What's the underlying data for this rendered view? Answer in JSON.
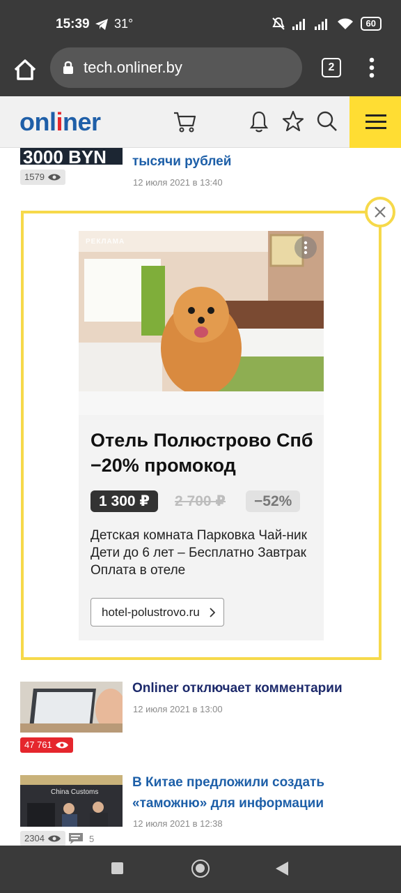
{
  "status_bar": {
    "time": "15:39",
    "temperature": "31°",
    "battery": "60"
  },
  "browser": {
    "url": "tech.onliner.by",
    "tab_count": "2"
  },
  "site": {
    "logo_prefix": "onl",
    "logo_red": "i",
    "logo_suffix": "ner"
  },
  "news": [
    {
      "thumb_text": "3000 BYN",
      "title": "тысячи рублей",
      "date": "12 июля 2021 в 13:40",
      "views": "1579"
    },
    {
      "title": "Onliner отключает комментарии",
      "date": "12 июля 2021 в 13:00",
      "views": "47 761"
    },
    {
      "thumb_text": "China Customs",
      "title": "В Китае предложили создать «таможню» для информации",
      "date": "12 июля 2021 в 12:38",
      "views": "2304",
      "comments": "5"
    }
  ],
  "ad": {
    "label": "РЕКЛАМА",
    "title": "Отель Полюстрово Спб −20% промокод",
    "price_new": "1 300 ₽",
    "price_old": "2 700 ₽",
    "discount": "−52%",
    "description": "Детская комната Парковка Чай-ник Дети до 6 лет – Бесплатно Завтрак Оплата в отеле",
    "link": "hotel-polustrovo.ru"
  },
  "colors": {
    "brand_blue": "#1f5fa8",
    "brand_red": "#e5262d",
    "accent_yellow": "#ffdd33",
    "frame_yellow": "#f6d94a"
  }
}
